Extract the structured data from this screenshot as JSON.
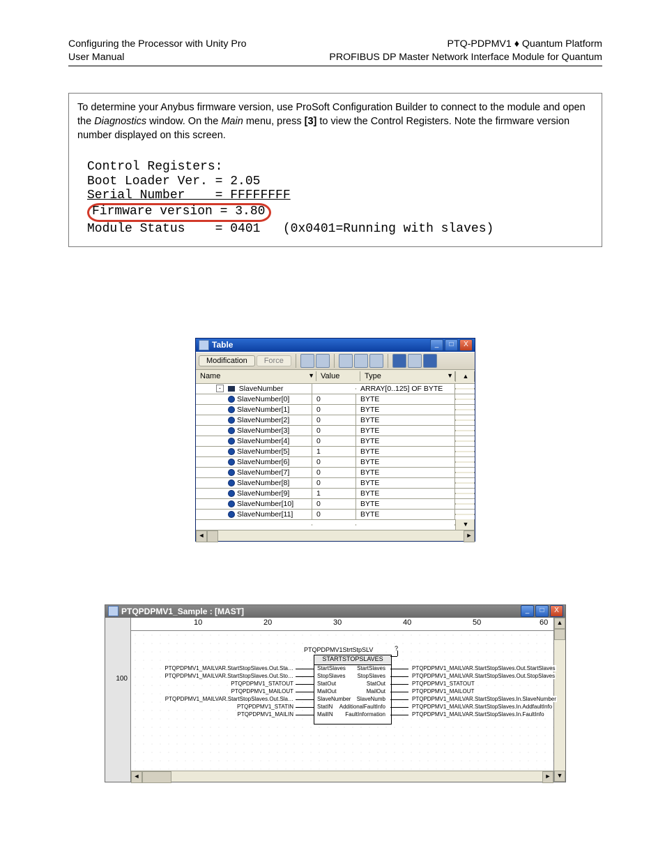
{
  "header": {
    "left1": "Configuring the Processor with Unity Pro",
    "left2": "User Manual",
    "right1": "PTQ-PDPMV1 ♦ Quantum Platform",
    "right2": "PROFIBUS DP Master Network Interface Module for Quantum"
  },
  "note": {
    "text_a": "To determine your Anybus firmware version, use ProSoft Configuration Builder to connect to the module and open the ",
    "diag": "Diagnostics",
    "text_b": " window. On the ",
    "main": "Main",
    "text_c": " menu, press ",
    "key": "[3]",
    "text_d": " to view the Control Registers. Note the firmware version number displayed on this screen.",
    "mono": {
      "l1": "Control Registers:",
      "l2": "Boot Loader Ver. = 2.05",
      "l3": "Serial Number    = FFFFFFFF",
      "l4": "Firmware version = 3.80",
      "l5": "Module Status    = 0401   (0x0401=Running with slaves)"
    }
  },
  "table_window": {
    "title": "Table",
    "btn_modification": "Modification",
    "btn_force": "Force",
    "col_name": "Name",
    "col_value": "Value",
    "col_type": "Type",
    "root": "SlaveNumber",
    "root_type": "ARRAY[0..125] OF BYTE",
    "rows": [
      {
        "name": "SlaveNumber[0]",
        "value": "0",
        "type": "BYTE"
      },
      {
        "name": "SlaveNumber[1]",
        "value": "0",
        "type": "BYTE"
      },
      {
        "name": "SlaveNumber[2]",
        "value": "0",
        "type": "BYTE"
      },
      {
        "name": "SlaveNumber[3]",
        "value": "0",
        "type": "BYTE"
      },
      {
        "name": "SlaveNumber[4]",
        "value": "0",
        "type": "BYTE"
      },
      {
        "name": "SlaveNumber[5]",
        "value": "1",
        "type": "BYTE"
      },
      {
        "name": "SlaveNumber[6]",
        "value": "0",
        "type": "BYTE"
      },
      {
        "name": "SlaveNumber[7]",
        "value": "0",
        "type": "BYTE"
      },
      {
        "name": "SlaveNumber[8]",
        "value": "0",
        "type": "BYTE"
      },
      {
        "name": "SlaveNumber[9]",
        "value": "1",
        "type": "BYTE"
      },
      {
        "name": "SlaveNumber[10]",
        "value": "0",
        "type": "BYTE"
      },
      {
        "name": "SlaveNumber[11]",
        "value": "0",
        "type": "BYTE"
      }
    ]
  },
  "fbd_window": {
    "title": "PTQPDPMV1_Sample : [MAST]",
    "gutter": "100",
    "ruler": [
      "10",
      "20",
      "30",
      "40",
      "50",
      "60"
    ],
    "block_top": "PTQPDPMV1StrtStpSLV",
    "block_main": "STARTSTOPSLAVES",
    "left_signals": [
      "PTQPDPMV1_MAILVAR.StartStopSlaves.Out.Sta…",
      "PTQPDPMV1_MAILVAR.StartStopSlaves.Out.Sto…",
      "PTQPDPMV1_STATOUT",
      "PTQPDPMV1_MAILOUT",
      "PTQPDPMV1_MAILVAR.StartStopSlaves.Out.Sla…",
      "PTQPDPMV1_STATIN",
      "PTQPDPMV1_MAILIN"
    ],
    "left_pins": [
      "StartSlaves",
      "StopSlaves",
      "StatOut",
      "MailOut",
      "SlaveNumber",
      "StatIN",
      "MailIN"
    ],
    "right_pins": [
      "StartSlaves",
      "StopSlaves",
      "StatOut",
      "MailOut",
      "SlaveNumb",
      "AdditionalFaultInfo",
      "FaultInformation"
    ],
    "right_signals": [
      "PTQPDPMV1_MAILVAR.StartStopSlaves.Out.StartSlaves",
      "PTQPDPMV1_MAILVAR.StartStopSlaves.Out.StopSlaves",
      "PTQPDPMV1_STATOUT",
      "PTQPDPMV1_MAILOUT",
      "PTQPDPMV1_MAILVAR.StartStopSlaves.In.SlaveNumber",
      "PTQPDPMV1_MAILVAR.StartStopSlaves.In.AddfaultInfo",
      "PTQPDPMV1_MAILVAR.StartStopSlaves.In.FaultInfo"
    ]
  }
}
